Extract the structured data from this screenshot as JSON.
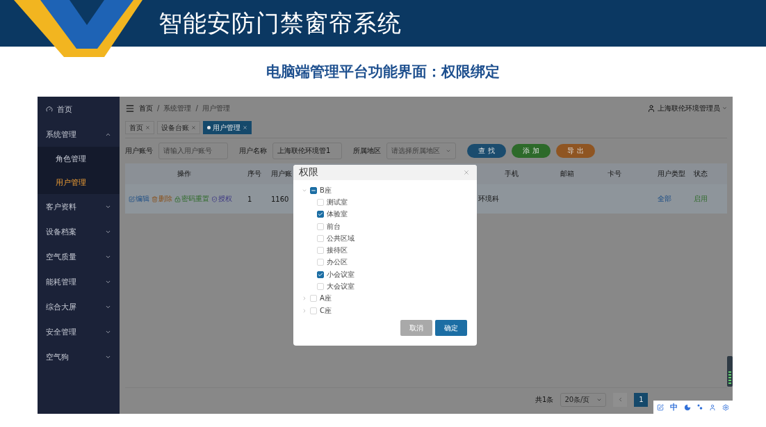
{
  "slide": {
    "title": "智能安防门禁窗帘系统",
    "subtitle": "电脑端管理平台功能界面：权限绑定"
  },
  "sidebar": {
    "items": [
      {
        "kind": "link",
        "label": "首页"
      },
      {
        "kind": "group",
        "label": "系统管理",
        "expanded": true,
        "children": [
          {
            "label": "角色管理",
            "selected": false
          },
          {
            "label": "用户管理",
            "selected": true
          }
        ]
      },
      {
        "kind": "group",
        "label": "客户资料",
        "expanded": false
      },
      {
        "kind": "group",
        "label": "设备档案",
        "expanded": false
      },
      {
        "kind": "group",
        "label": "空气质量",
        "expanded": false
      },
      {
        "kind": "group",
        "label": "能耗管理",
        "expanded": false
      },
      {
        "kind": "group",
        "label": "综合大屏",
        "expanded": false
      },
      {
        "kind": "group",
        "label": "安全管理",
        "expanded": false
      },
      {
        "kind": "group",
        "label": "空气狗",
        "expanded": false
      }
    ]
  },
  "topbar": {
    "breadcrumb": [
      "首页",
      "系统管理",
      "用户管理"
    ],
    "separator": "/",
    "user": "上海联伦环境管理员"
  },
  "tabs": [
    {
      "label": "首页",
      "selected": false
    },
    {
      "label": "设备台账",
      "selected": false
    },
    {
      "label": "用户管理",
      "selected": true
    }
  ],
  "filters": [
    {
      "kind": "text",
      "label": "用户账号",
      "placeholder": "请输入用户账号"
    },
    {
      "kind": "text",
      "label": "用户名称",
      "value": "上海联伦环境管1"
    },
    {
      "kind": "select",
      "label": "所属地区",
      "placeholder": "请选择所属地区"
    }
  ],
  "buttons": [
    {
      "label": "查 找",
      "color": "#1b4c6e"
    },
    {
      "label": "添 加",
      "color": "#2d6a2a"
    },
    {
      "label": "导 出",
      "color": "#8f5522"
    }
  ],
  "table": {
    "columns": [
      "操作",
      "序号",
      "用户账",
      "",
      "手机",
      "邮箱",
      "卡号",
      "用户类型",
      "状态"
    ],
    "rows": [
      {
        "cells": [
          {
            "actions": [
              {
                "label": "编辑",
                "kind": "edit"
              },
              {
                "label": "删除",
                "kind": "delete"
              },
              {
                "label": "密码重置",
                "kind": "reset"
              },
              {
                "label": "授权",
                "kind": "grant"
              }
            ]
          },
          "1",
          "1160",
          "环境科",
          "",
          "",
          "",
          "全部",
          "启用"
        ]
      }
    ]
  },
  "dialog": {
    "title": "权限",
    "tree": [
      {
        "label": "B座",
        "expanded": true,
        "checked": false,
        "indeterminate": true,
        "children": [
          {
            "label": "测试室",
            "checked": false
          },
          {
            "label": "体验室",
            "checked": true
          },
          {
            "label": "前台",
            "checked": false
          },
          {
            "label": "公共区域",
            "checked": false
          },
          {
            "label": "接待区",
            "checked": false
          },
          {
            "label": "办公区",
            "checked": false
          },
          {
            "label": "小会议室",
            "checked": true
          },
          {
            "label": "大会议室",
            "checked": false
          }
        ]
      },
      {
        "label": "A座",
        "expanded": false,
        "checked": false,
        "indeterminate": false
      },
      {
        "label": "C座",
        "expanded": false,
        "checked": false,
        "indeterminate": false
      }
    ],
    "buttons": [
      {
        "label": "取消",
        "kind": "cancel"
      },
      {
        "label": "确定",
        "kind": "confirm"
      }
    ]
  },
  "pagination": {
    "total": "共1条",
    "page_size": "20条/页",
    "pages": [
      {
        "label": "1",
        "selected": true
      }
    ]
  },
  "ime": {
    "label": "中"
  }
}
